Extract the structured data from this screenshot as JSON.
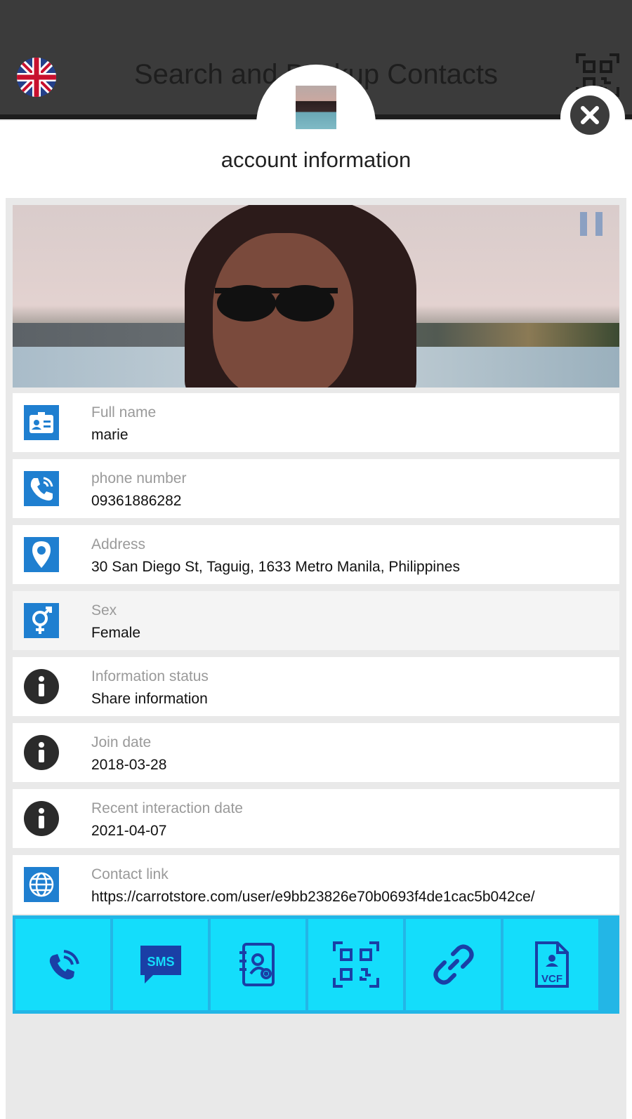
{
  "header": {
    "title": "Search and Backup Contacts",
    "language_icon": "uk-flag-icon",
    "qr_icon": "qr-code-icon"
  },
  "dialog": {
    "title": "account information",
    "close_icon": "close-icon"
  },
  "fields": [
    {
      "label": "Full name",
      "value": "marie",
      "icon": "id-card-icon"
    },
    {
      "label": "phone number",
      "value": "09361886282",
      "icon": "phone-icon"
    },
    {
      "label": "Address",
      "value": "30 San Diego St, Taguig, 1633 Metro Manila, Philippines",
      "icon": "location-pin-icon"
    },
    {
      "label": "Sex",
      "value": "Female",
      "icon": "gender-icon"
    },
    {
      "label": "Information status",
      "value": "Share information",
      "icon": "info-icon"
    },
    {
      "label": "Join date",
      "value": "2018-03-28",
      "icon": "info-icon"
    },
    {
      "label": "Recent interaction date",
      "value": "2021-04-07",
      "icon": "info-icon"
    },
    {
      "label": "Contact link",
      "value": "https://carrotstore.com/user/e9bb23826e70b0693f4de1cac5b042ce/",
      "icon": "globe-icon"
    }
  ],
  "actions": [
    {
      "name": "call",
      "icon": "call-icon"
    },
    {
      "name": "sms",
      "icon": "sms-icon",
      "text": "SMS"
    },
    {
      "name": "add-contact",
      "icon": "add-contact-icon"
    },
    {
      "name": "qr-code",
      "icon": "qr-code-icon"
    },
    {
      "name": "copy-link",
      "icon": "link-icon"
    },
    {
      "name": "vcf-export",
      "icon": "vcf-file-icon",
      "text": "VCF"
    }
  ],
  "colors": {
    "topbar": "#3b3b3b",
    "accent_blue": "#1f7fd0",
    "action_bar": "#14ddfb",
    "action_icon": "#1a3fa6"
  }
}
